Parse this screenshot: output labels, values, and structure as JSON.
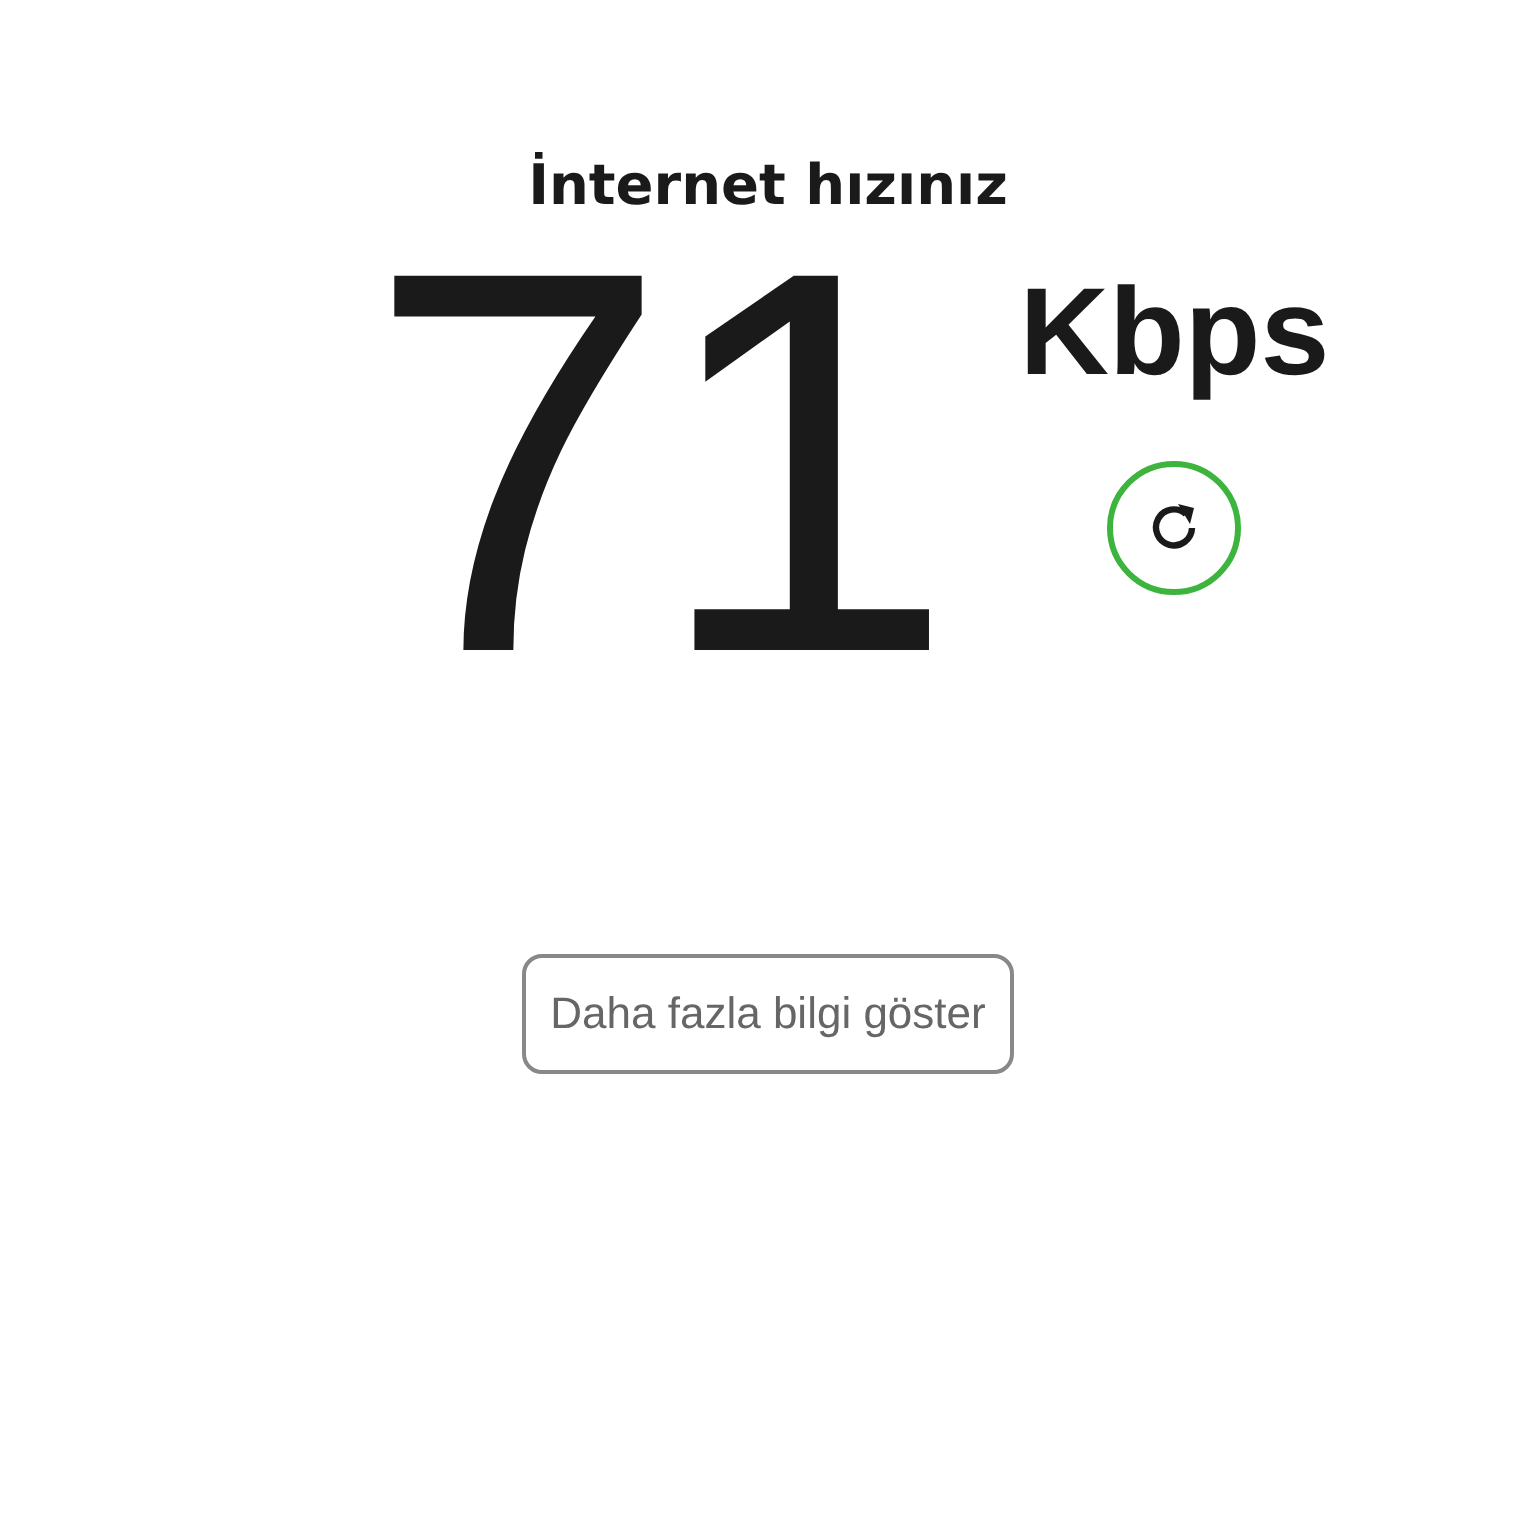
{
  "title": "İnternet hızınız",
  "speed": {
    "value": "71",
    "unit": "Kbps"
  },
  "more_button": {
    "label": "Daha fazla bilgi göster"
  }
}
